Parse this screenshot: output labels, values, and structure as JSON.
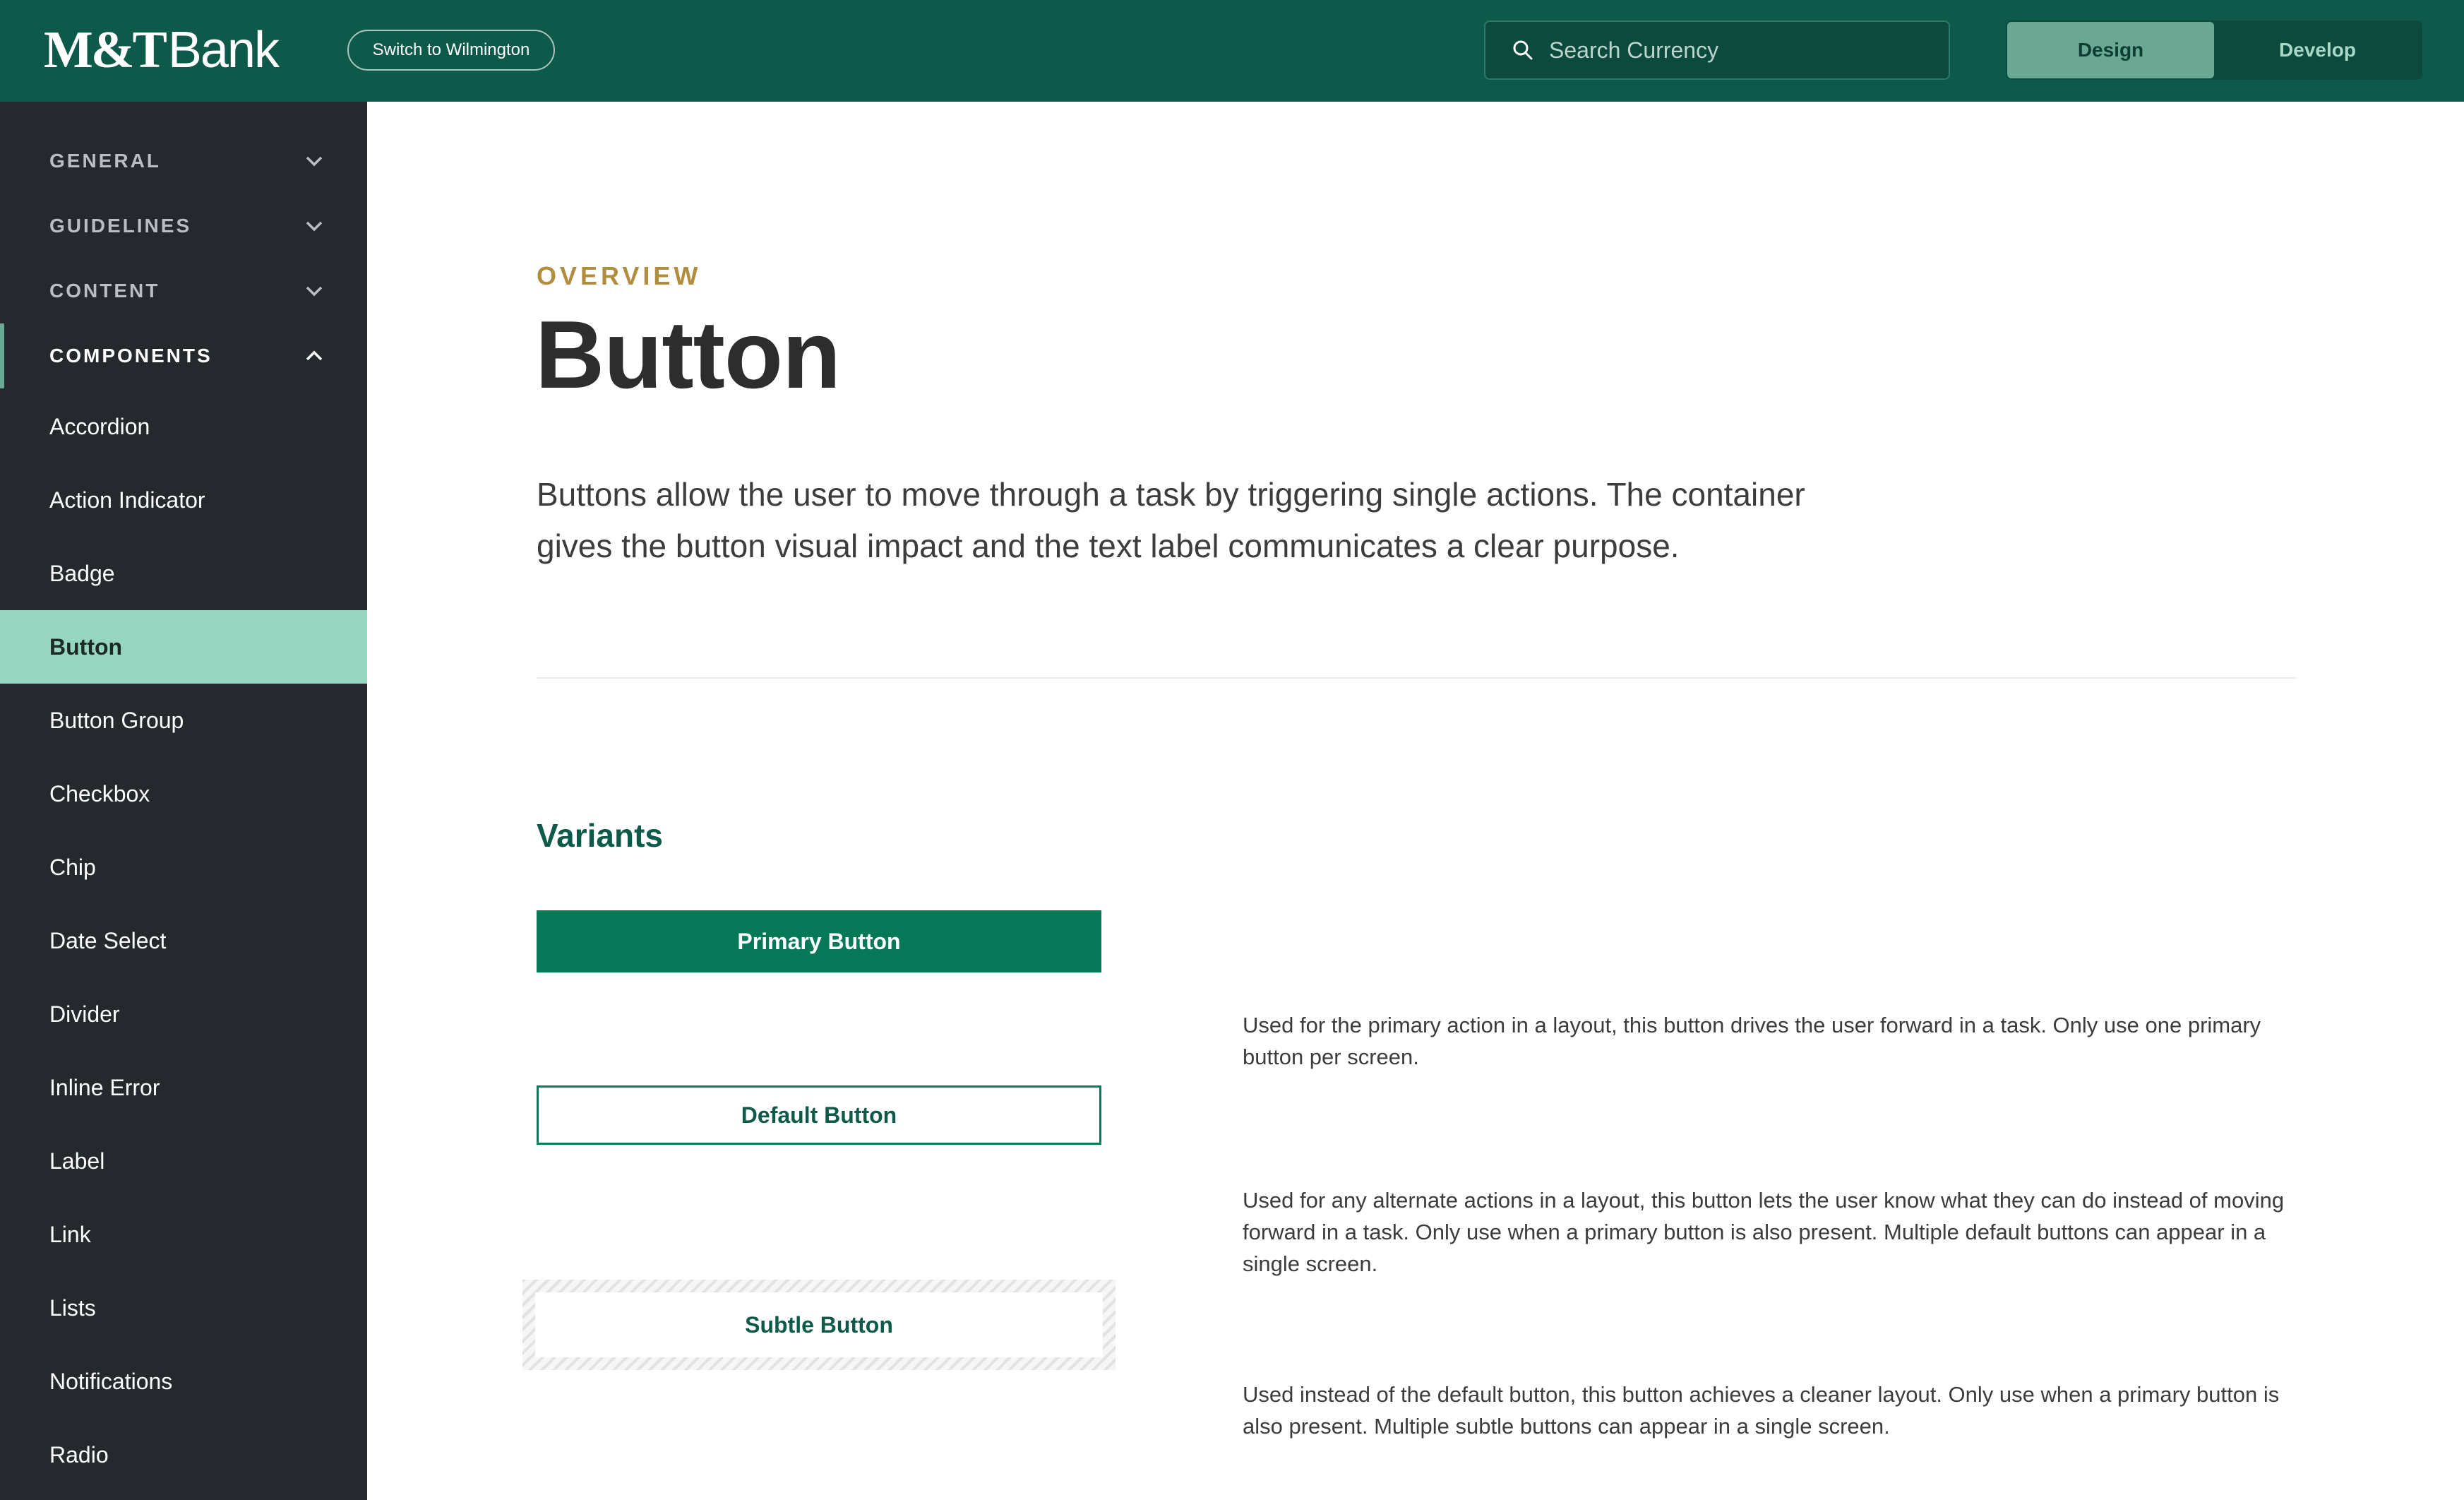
{
  "header": {
    "logo_mt": "M&T",
    "logo_bank": "Bank",
    "switch_label": "Switch to Wilmington",
    "search_placeholder": "Search Currency",
    "modes": [
      {
        "label": "Design",
        "active": true
      },
      {
        "label": "Develop",
        "active": false
      }
    ]
  },
  "sidebar": {
    "sections": [
      {
        "label": "GENERAL",
        "icon": "chevron-down-icon"
      },
      {
        "label": "GUIDELINES",
        "icon": "chevron-down-icon"
      },
      {
        "label": "CONTENT",
        "icon": "chevron-down-icon"
      },
      {
        "label": "COMPONENTS",
        "icon": "chevron-up-icon"
      }
    ],
    "items": [
      "Accordion",
      "Action Indicator",
      "Badge",
      "Button",
      "Button Group",
      "Checkbox",
      "Chip",
      "Date Select",
      "Divider",
      "Inline Error",
      "Label",
      "Link",
      "Lists",
      "Notifications",
      "Radio"
    ],
    "active_item": "Button"
  },
  "main": {
    "eyebrow": "OVERVIEW",
    "title": "Button",
    "lead": "Buttons allow the user to move through a task by triggering single actions. The container gives the button visual impact and the text label communicates a clear purpose.",
    "variants_title": "Variants",
    "variants": [
      {
        "label": "Primary Button",
        "description": "Used for the primary action in a layout, this button drives the user forward in a task. Only use one primary button per screen."
      },
      {
        "label": "Default Button",
        "description": "Used for any alternate actions in a layout, this button lets the user know what they can do instead of moving forward in a task. Only use when a primary button is also present. Multiple default buttons can appear in a single screen."
      },
      {
        "label": "Subtle Button",
        "description": "Used instead of the default button, this button achieves a cleaner layout. Only use when a primary button is also present. Multiple subtle buttons can appear in a single screen."
      }
    ]
  },
  "colors": {
    "header_bg": "#0e5a4a",
    "sidebar_bg": "#25282c",
    "active_item_bg": "#96d5c0",
    "primary_button": "#047857",
    "eyebrow": "#b08e3e"
  }
}
